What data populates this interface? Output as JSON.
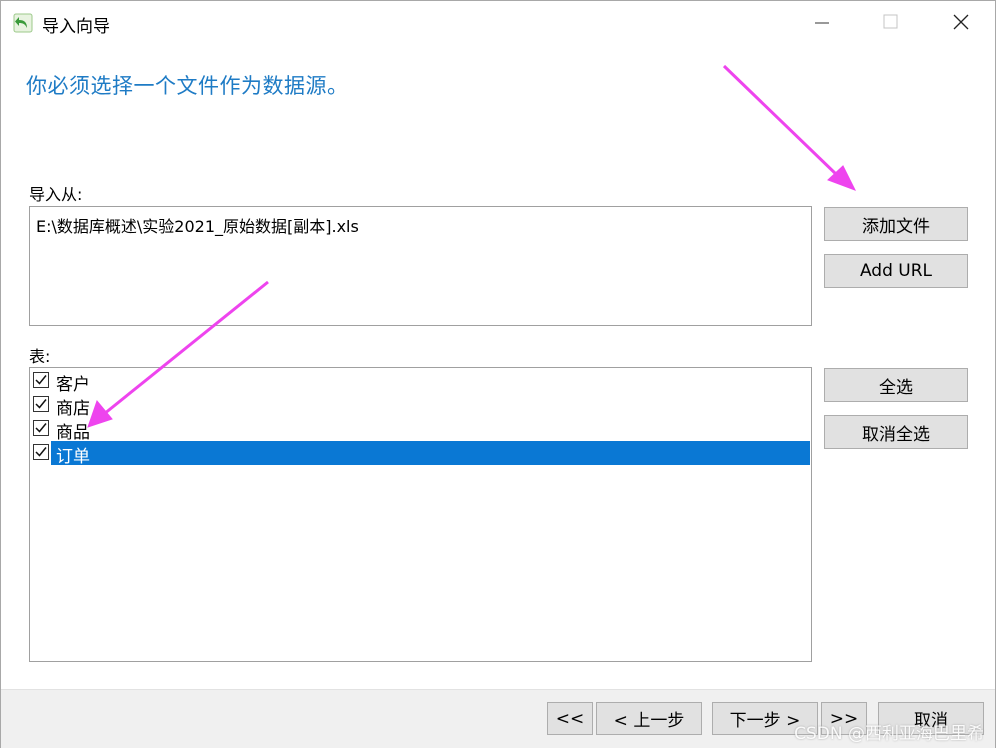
{
  "window": {
    "title": "导入向导",
    "icon": "back-arrow-icon"
  },
  "heading": "你必须选择一个文件作为数据源。",
  "import_from": {
    "label": "导入从:",
    "path": "E:\\数据库概述\\实验2021_原始数据[副本].xls"
  },
  "side_buttons": {
    "add_file": "添加文件",
    "add_url": "Add URL",
    "select_all": "全选",
    "deselect_all": "取消全选"
  },
  "tables": {
    "label": "表:",
    "items": [
      {
        "name": "客户",
        "checked": true,
        "selected": false
      },
      {
        "name": "商店",
        "checked": true,
        "selected": false
      },
      {
        "name": "商品",
        "checked": true,
        "selected": false
      },
      {
        "name": "订单",
        "checked": true,
        "selected": true
      }
    ]
  },
  "footer": {
    "first": "<<",
    "prev": "< 上一步",
    "next": "下一步 >",
    "last": ">>",
    "cancel": "取消"
  },
  "watermark": "CSDN @西利亚海巴里希",
  "colors": {
    "heading": "#1e7bc5",
    "selection": "#0a78d4",
    "annotation_arrow": "#ee44ee"
  }
}
